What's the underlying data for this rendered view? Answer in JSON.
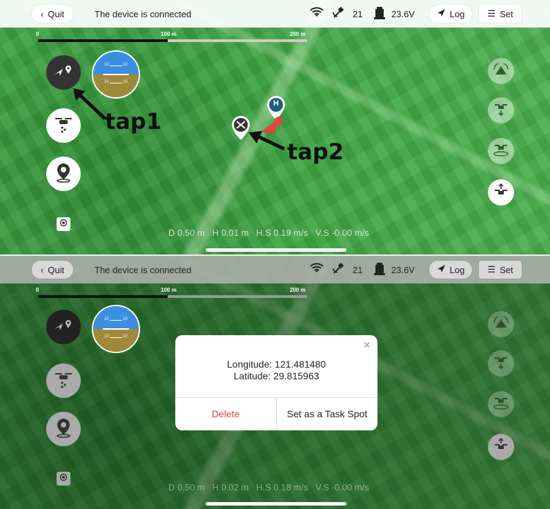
{
  "topbar": {
    "quit_label": "Quit",
    "status_text": "The device is connected",
    "satellite_count": "21",
    "voltage": "23.6V",
    "log_label": "Log",
    "set_label": "Set"
  },
  "scale": {
    "labels": [
      "0",
      "100 m",
      "200 m"
    ]
  },
  "panels": [
    {
      "telemetry": {
        "d": "D 0.50 m",
        "h": "H 0.01 m",
        "hs": "H.S 0.19 m/s",
        "vs": "V.S -0.00 m/s"
      }
    },
    {
      "telemetry": {
        "d": "D 0.50 m",
        "h": "H 0.02 m",
        "hs": "H.S 0.18 m/s",
        "vs": "V.S -0.00 m/s"
      }
    }
  ],
  "attitude": {
    "labels": [
      "10",
      "10",
      "10",
      "10"
    ]
  },
  "annotations": {
    "tap1": "tap1",
    "tap2": "tap2"
  },
  "home_marker": "H",
  "dialog": {
    "longitude": "Longitude: 121.481480",
    "latitude": "Latitude: 29.815963",
    "delete_label": "Delete",
    "task_label": "Set as a Task Spot",
    "close_glyph": "×"
  },
  "colors": {
    "delete": "#e0443b",
    "accent": "#2a6a8a",
    "home_marker": "#1f5d80"
  },
  "icons": [
    "back-chevron-icon",
    "wifi-icon",
    "satellite-icon",
    "battery-icon",
    "send-icon",
    "menu-icon",
    "plane-location-icon",
    "drone-icon",
    "location-pin-icon",
    "locate-icon",
    "takeoff-icon",
    "land-icon",
    "hover-icon",
    "return-icon"
  ]
}
